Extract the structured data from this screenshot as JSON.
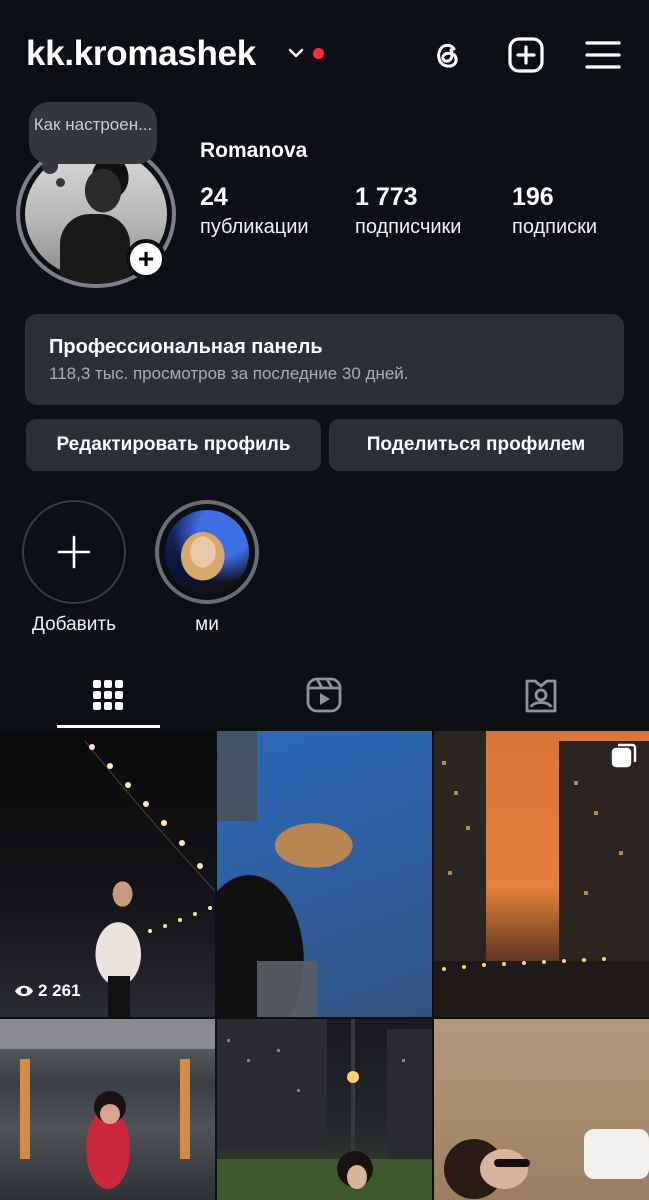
{
  "header": {
    "username": "kk.kromashek",
    "icons": [
      "chevron-down-icon",
      "threads-icon",
      "create-icon",
      "menu-icon"
    ]
  },
  "profile": {
    "note": "Как настроен...",
    "full_name": "Romanova",
    "stats": [
      {
        "value": "24",
        "label": "публикации"
      },
      {
        "value": "1 773",
        "label": "подписчики"
      },
      {
        "value": "196",
        "label": "подписки"
      }
    ]
  },
  "pro_panel": {
    "title": "Профессиональная панель",
    "subtitle": "118,3 тыс. просмотров за последние 30 дней."
  },
  "buttons": {
    "edit": "Редактировать профиль",
    "share": "Поделиться профилем"
  },
  "highlights": [
    {
      "label": "Добавить"
    },
    {
      "label": "ми"
    }
  ],
  "tabs": [
    "grid-icon",
    "reels-icon",
    "tagged-icon"
  ],
  "posts": [
    {
      "views": "2 261"
    }
  ],
  "colors": {
    "background": "#0c0f14",
    "panel": "#2b2f36",
    "notification_dot": "#ff2d3d"
  }
}
